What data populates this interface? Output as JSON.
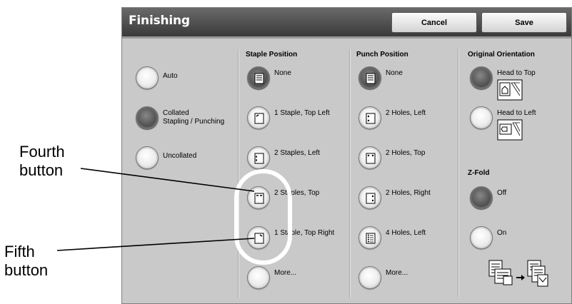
{
  "window": {
    "title": "Finishing"
  },
  "header": {
    "cancel_label": "Cancel",
    "save_label": "Save"
  },
  "finishing": {
    "options": [
      "Auto",
      "Collated\nStapling / Punching",
      "Uncollated"
    ]
  },
  "staple": {
    "heading": "Staple Position",
    "options": [
      "None",
      "1 Staple, Top Left",
      "2 Staples, Left",
      "2 Staples, Top",
      "1 Staple, Top Right",
      "More..."
    ]
  },
  "punch": {
    "heading": "Punch Position",
    "options": [
      "None",
      "2 Holes, Left",
      "2 Holes, Top",
      "2 Holes, Right",
      "4 Holes, Left",
      "More..."
    ]
  },
  "orientation": {
    "heading": "Original Orientation",
    "options": [
      "Head to Top",
      "Head to Left"
    ]
  },
  "zfold": {
    "heading": "Z-Fold",
    "options": [
      "Off",
      "On"
    ]
  },
  "annotations": {
    "fourth": "Fourth\nbutton",
    "fifth": "Fifth\nbutton"
  },
  "colors": {
    "title_bar": "#4a4a4a",
    "panel": "#c9c9c9",
    "highlight_ring": "#ffffff"
  }
}
